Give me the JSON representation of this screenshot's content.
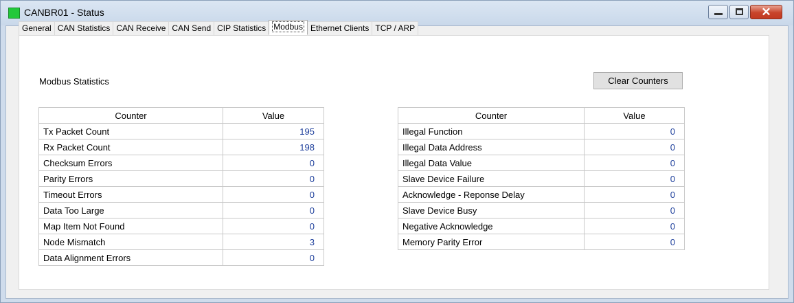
{
  "window": {
    "title": "CANBR01 - Status",
    "accent_icon_color": "#22c83a"
  },
  "tabs": [
    {
      "label": "General",
      "active": false
    },
    {
      "label": "CAN Statistics",
      "active": false
    },
    {
      "label": "CAN Receive",
      "active": false
    },
    {
      "label": "CAN Send",
      "active": false
    },
    {
      "label": "CIP Statistics",
      "active": false
    },
    {
      "label": "Modbus",
      "active": true
    },
    {
      "label": "Ethernet Clients",
      "active": false
    },
    {
      "label": "TCP / ARP",
      "active": false
    }
  ],
  "modbus": {
    "section_label": "Modbus Statistics",
    "clear_button": "Clear Counters",
    "left_table": {
      "headers": [
        "Counter",
        "Value"
      ],
      "rows": [
        {
          "counter": "Tx Packet Count",
          "value": "195"
        },
        {
          "counter": "Rx Packet Count",
          "value": "198"
        },
        {
          "counter": "Checksum Errors",
          "value": "0"
        },
        {
          "counter": "Parity Errors",
          "value": "0"
        },
        {
          "counter": "Timeout Errors",
          "value": "0"
        },
        {
          "counter": "Data Too Large",
          "value": "0"
        },
        {
          "counter": "Map Item Not Found",
          "value": "0"
        },
        {
          "counter": "Node Mismatch",
          "value": "3"
        },
        {
          "counter": "Data Alignment Errors",
          "value": "0"
        }
      ]
    },
    "right_table": {
      "headers": [
        "Counter",
        "Value"
      ],
      "rows": [
        {
          "counter": "Illegal Function",
          "value": "0"
        },
        {
          "counter": "Illegal Data Address",
          "value": "0"
        },
        {
          "counter": "Illegal Data Value",
          "value": "0"
        },
        {
          "counter": "Slave Device Failure",
          "value": "0"
        },
        {
          "counter": "Acknowledge - Reponse Delay",
          "value": "0"
        },
        {
          "counter": "Slave Device Busy",
          "value": "0"
        },
        {
          "counter": "Negative Acknowledge",
          "value": "0"
        },
        {
          "counter": "Memory Parity Error",
          "value": "0"
        }
      ]
    }
  }
}
